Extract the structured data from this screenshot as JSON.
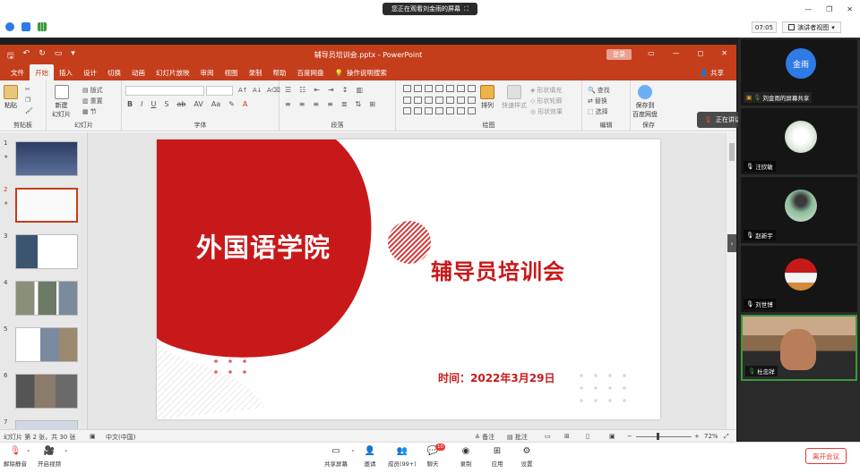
{
  "meeting": {
    "banner": "您正在观看刘金雨的屏幕",
    "time": "07:05",
    "view_mode": "演讲者视图",
    "speaking": "正在讲话：赵金雨",
    "colors": {
      "accent": "#2e7be6",
      "danger": "#e53935"
    }
  },
  "ppt": {
    "title": "辅导员培训会.pptx - PowerPoint",
    "login": "登录",
    "share": "共享",
    "tabs": [
      "文件",
      "开始",
      "插入",
      "设计",
      "切换",
      "动画",
      "幻灯片放映",
      "审阅",
      "视图",
      "录制",
      "帮助",
      "百度网盘",
      "操作说明搜索"
    ],
    "active_tab": "开始",
    "ribbon": {
      "clipboard": {
        "paste": "粘贴",
        "label": "剪贴板"
      },
      "slides": {
        "new_slide": "新建\n幻灯片",
        "layout": "版式",
        "reset": "重置",
        "section": "节",
        "label": "幻灯片"
      },
      "font_label": "字体",
      "paragraph_label": "段落",
      "drawing": {
        "arrange": "排列",
        "quick_styles": "快速样式",
        "fill": "形状填充",
        "outline": "形状轮廓",
        "effects": "形状效果",
        "label": "绘图"
      },
      "editing": {
        "find": "查找",
        "replace": "替换",
        "select": "选择",
        "label": "编辑"
      },
      "save": {
        "save_to": "保存到\n百度网盘",
        "label": "保存"
      }
    },
    "slide": {
      "school": "外国语学院",
      "title": "辅导员培训会",
      "time_label": "时间：2022年3月29日"
    },
    "thumbnails": [
      {
        "num": "1",
        "star": "★"
      },
      {
        "num": "2",
        "star": "★"
      },
      {
        "num": "3",
        "star": ""
      },
      {
        "num": "4",
        "star": ""
      },
      {
        "num": "5",
        "star": ""
      },
      {
        "num": "6",
        "star": ""
      },
      {
        "num": "7",
        "star": ""
      }
    ],
    "status": {
      "slide_info": "幻灯片 第 2 张，共 30 张",
      "lang": "中文(中国)",
      "notes": "备注",
      "comments": "批注",
      "zoom": "72%"
    }
  },
  "participants": [
    {
      "name": "金雨",
      "caption": "刘金雨的屏幕共享"
    },
    {
      "name": "汪欣敏"
    },
    {
      "name": "赵新宇"
    },
    {
      "name": "刘世博"
    },
    {
      "name": "杜忠祥"
    }
  ],
  "bottom": {
    "mute": "解除静音",
    "video": "开启视频",
    "share_screen": "共享屏幕",
    "invite": "邀请",
    "members": "成员(99+)",
    "chat": "聊天",
    "chat_badge": "10",
    "record": "录制",
    "apps": "应用",
    "settings": "设置",
    "leave": "离开会议"
  }
}
